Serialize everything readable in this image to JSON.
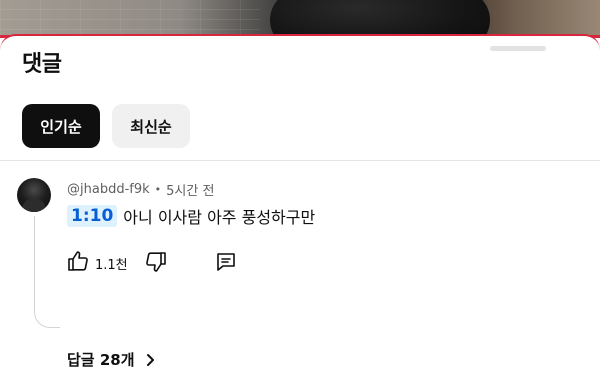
{
  "sheet": {
    "title": "댓글"
  },
  "sort_chips": [
    {
      "label": "인기순",
      "active": true
    },
    {
      "label": "최신순",
      "active": false
    }
  ],
  "comment": {
    "author": "@jhabdd-f9k",
    "separator": "•",
    "time_ago": "5시간 전",
    "timestamp_link": "1:10",
    "text": "아니 이사람 아주 풍성하구만",
    "like_count": "1.1천",
    "replies_label": "답글 28개"
  },
  "colors": {
    "accent_red": "#d7263d",
    "timestamp_bg": "#def1ff",
    "timestamp_fg": "#065fd4",
    "chip_active_bg": "#0f0f0f",
    "chip_inactive_bg": "#f0f0f0"
  },
  "icons": {
    "like": "thumbs-up-icon",
    "dislike": "thumbs-down-icon",
    "reply": "comment-icon",
    "expand": "chevron-right-icon"
  }
}
